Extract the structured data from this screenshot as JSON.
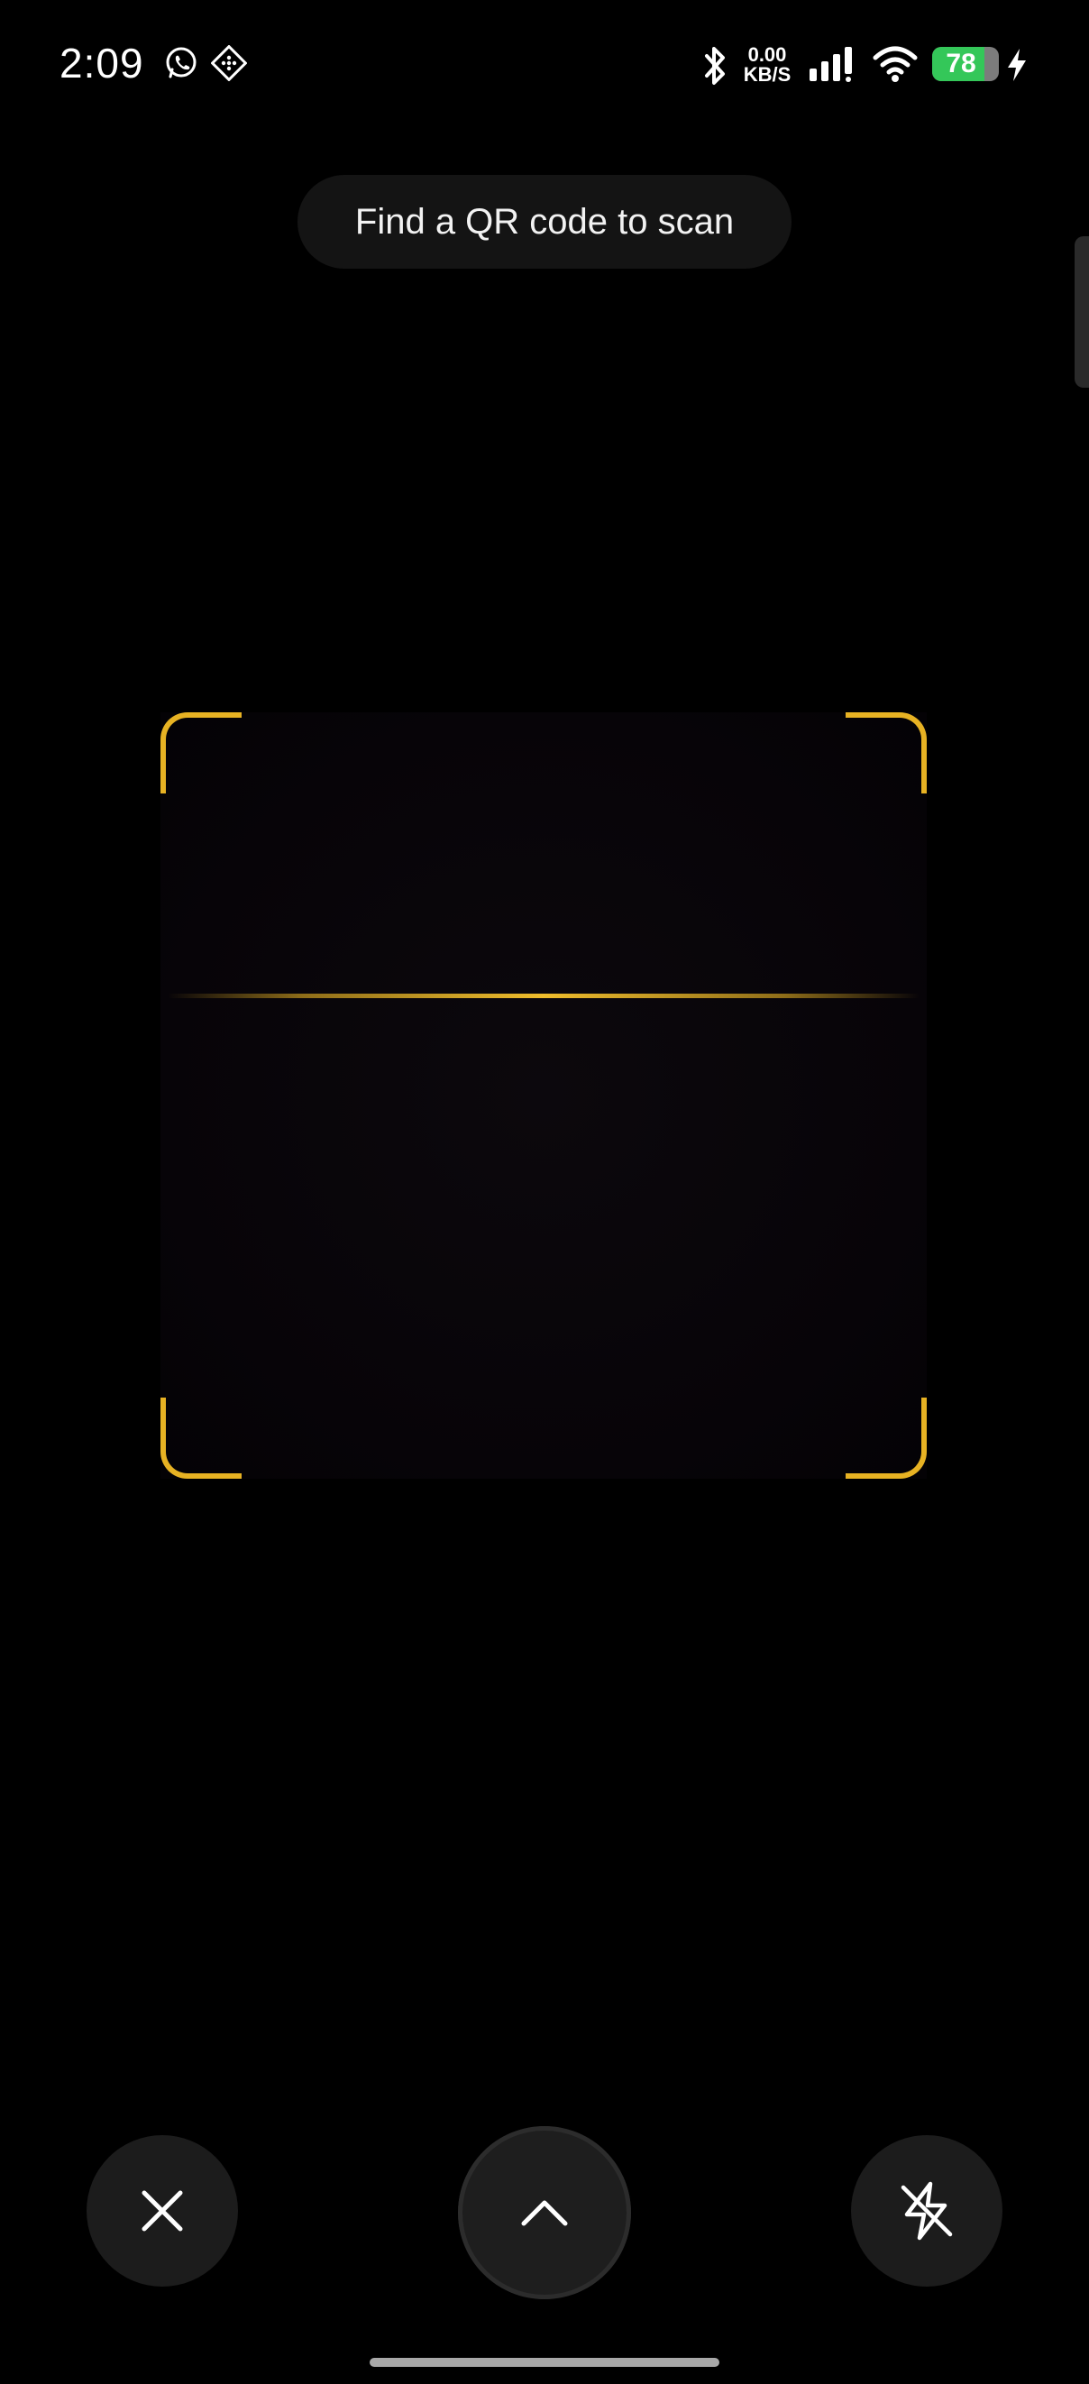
{
  "status_bar": {
    "time": "2:09",
    "left_icons": [
      "whatsapp-icon",
      "app-notification-icon"
    ],
    "net_speed_value": "0.00",
    "net_speed_unit": "KB/S",
    "right_icons": [
      "bluetooth-icon",
      "signal-icon",
      "wifi-icon",
      "charging-bolt-icon"
    ],
    "battery_level": "78",
    "battery_fraction": 0.78,
    "battery_color": "#34c759"
  },
  "scanner": {
    "hint_text": "Find a QR code to scan",
    "frame_color": "#e7b223"
  },
  "controls": {
    "close_icon": "close-icon",
    "expand_icon": "chevron-up-icon",
    "flash_icon": "flash-off-icon"
  }
}
